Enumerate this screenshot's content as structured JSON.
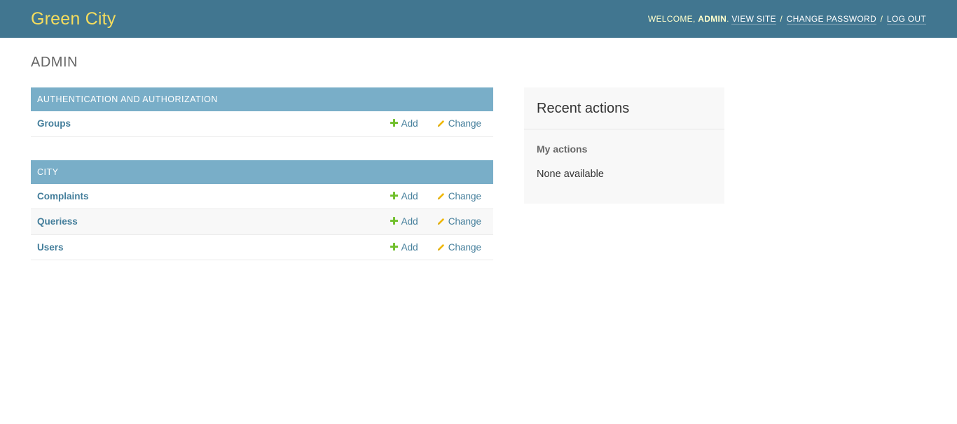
{
  "header": {
    "branding": "Green City",
    "welcome": "Welcome,",
    "username": "admin",
    "view_site": "View site",
    "change_password": "Change password",
    "log_out": "Log out",
    "separator": "/"
  },
  "page_title": "Admin",
  "modules": [
    {
      "caption": "Authentication and Authorization",
      "models": [
        {
          "name": "Groups",
          "add": "Add",
          "change": "Change"
        }
      ]
    },
    {
      "caption": "City",
      "models": [
        {
          "name": "Complaints",
          "add": "Add",
          "change": "Change"
        },
        {
          "name": "Queriess",
          "add": "Add",
          "change": "Change"
        },
        {
          "name": "Users",
          "add": "Add",
          "change": "Change"
        }
      ]
    }
  ],
  "recent_actions": {
    "title": "Recent actions",
    "my_actions": "My actions",
    "empty": "None available"
  },
  "icons": {
    "add": "plus-icon",
    "change": "pencil-icon"
  },
  "colors": {
    "header_bg": "#417690",
    "branding": "#f5dd5d",
    "caption_bg": "#79aec8",
    "link": "#447e9b",
    "add_icon": "#70bf2b",
    "change_icon": "#efb80b"
  }
}
